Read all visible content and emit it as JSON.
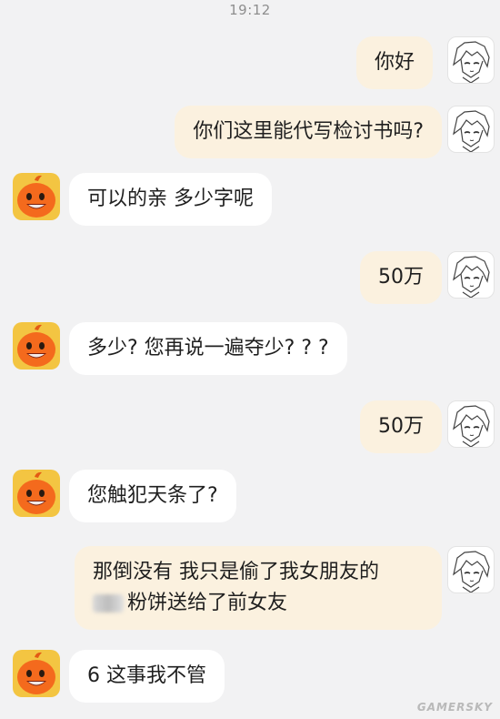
{
  "status_bar": {
    "time": "19:12"
  },
  "messages": [
    {
      "side": "out",
      "text": "你好"
    },
    {
      "side": "out",
      "text": "你们这里能代写检讨书吗?"
    },
    {
      "side": "in",
      "text": "可以的亲  多少字呢"
    },
    {
      "side": "out",
      "text": "50万"
    },
    {
      "side": "in",
      "text": "多少? 您再说一遍夺少? ? ?"
    },
    {
      "side": "out",
      "text": "50万"
    },
    {
      "side": "in",
      "text": "您触犯天条了?"
    },
    {
      "side": "out",
      "line1": "那倒没有  我只是偷了我女朋友的",
      "line2": "粉饼送给了前女友"
    },
    {
      "side": "in",
      "text": "6 这事我不管"
    }
  ],
  "watermark": "GAMERSKY"
}
